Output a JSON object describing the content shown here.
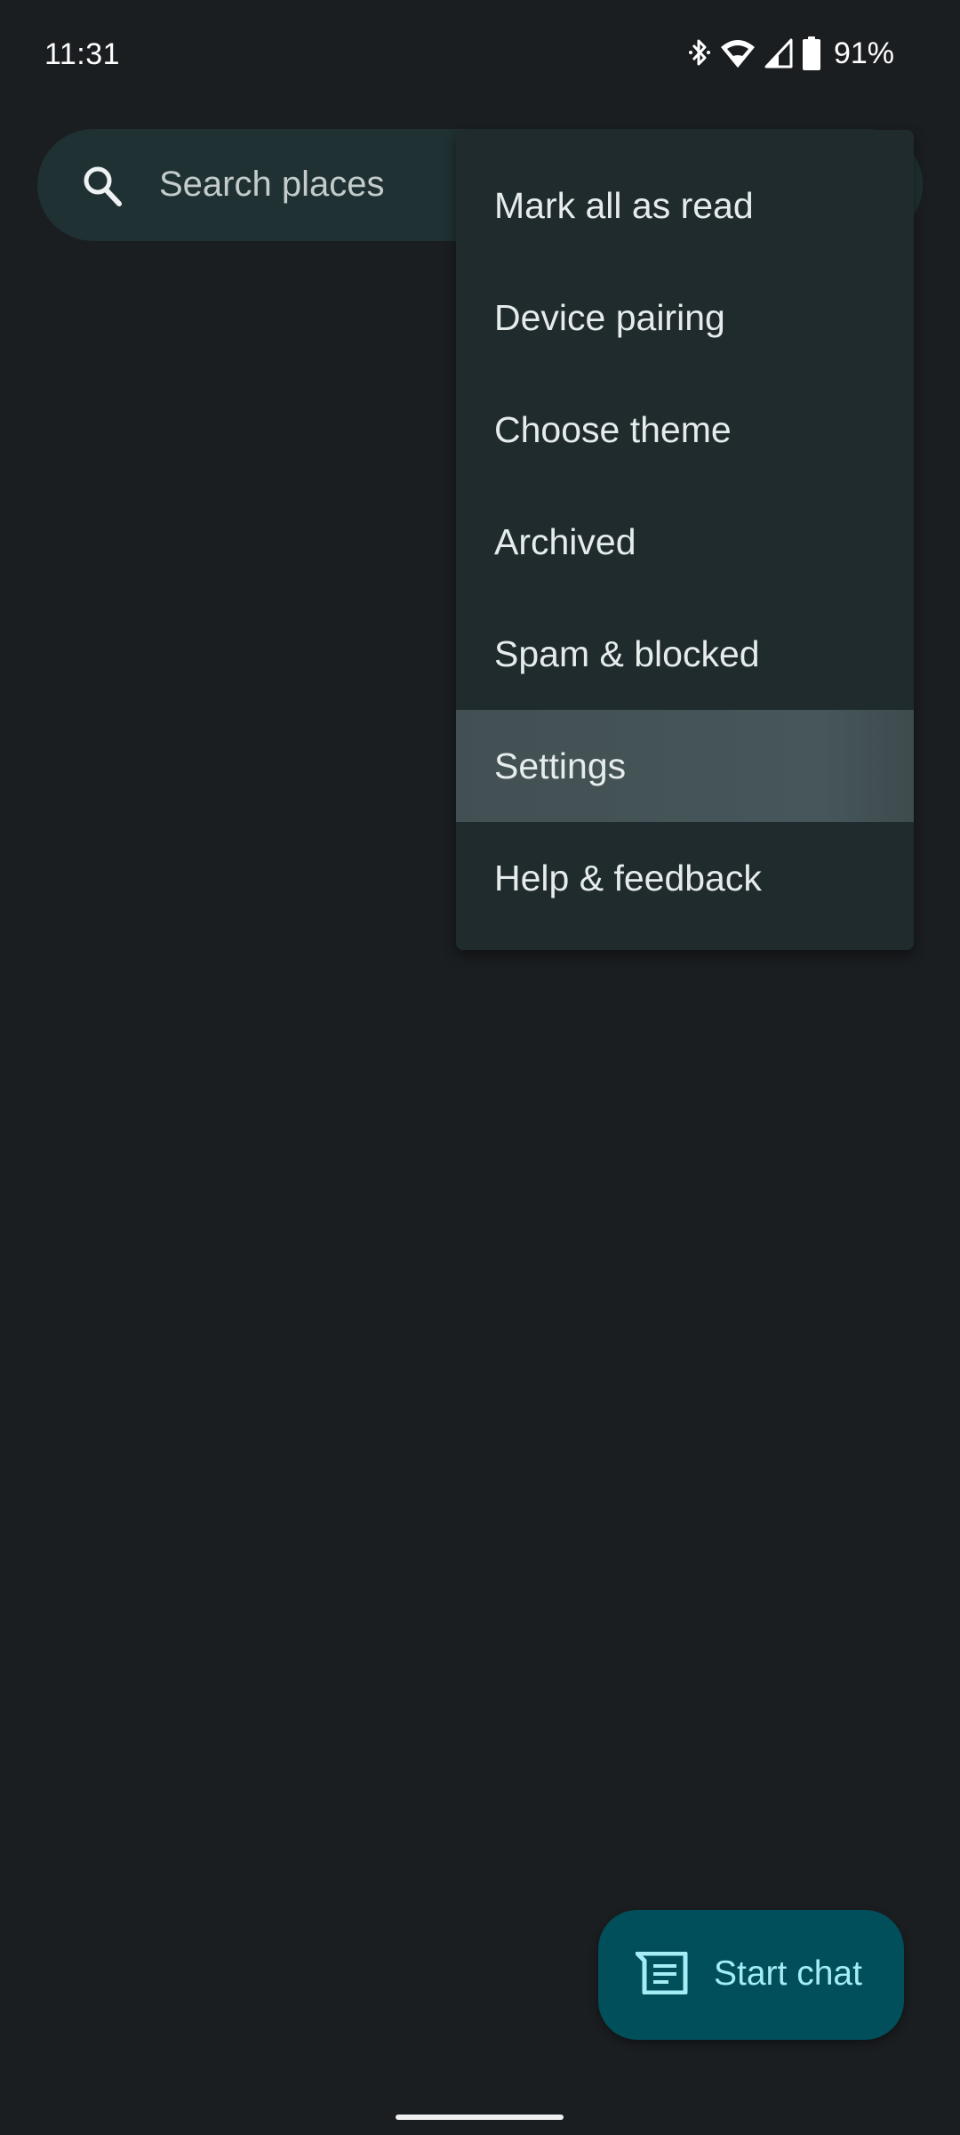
{
  "status_bar": {
    "time": "11:31",
    "icons": [
      "bluetooth-icon",
      "wifi-icon",
      "cell-signal-icon",
      "battery-icon"
    ],
    "battery_percent": "91%"
  },
  "search": {
    "placeholder": "Search places",
    "icon": "search-icon"
  },
  "overflow_menu": {
    "items": [
      {
        "label": "Mark all as read"
      },
      {
        "label": "Device pairing"
      },
      {
        "label": "Choose theme"
      },
      {
        "label": "Archived"
      },
      {
        "label": "Spam & blocked"
      },
      {
        "label": "Settings",
        "highlighted": true
      },
      {
        "label": "Help & feedback"
      }
    ]
  },
  "fab": {
    "label": "Start chat",
    "icon": "chat-icon"
  },
  "colors": {
    "background": "#1b1e21",
    "search_bar": "#1f3133",
    "menu": "#202b2e",
    "menu_highlight": "#46565a",
    "fab": "#004f5a",
    "fab_text": "#a4ecf6"
  }
}
